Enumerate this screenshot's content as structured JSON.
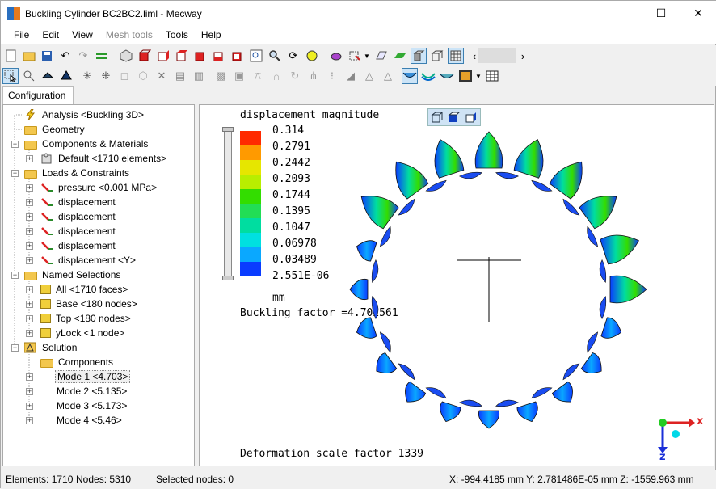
{
  "window": {
    "title": "Buckling Cylinder BC2BC2.liml - Mecway"
  },
  "menu": [
    {
      "label": "File",
      "disabled": false
    },
    {
      "label": "Edit",
      "disabled": false
    },
    {
      "label": "View",
      "disabled": false
    },
    {
      "label": "Mesh tools",
      "disabled": true
    },
    {
      "label": "Tools",
      "disabled": false
    },
    {
      "label": "Help",
      "disabled": false
    }
  ],
  "tabs": {
    "configuration": "Configuration"
  },
  "tree": {
    "analysis": "Analysis <Buckling 3D>",
    "geometry": "Geometry",
    "components_materials": "Components & Materials",
    "default": "Default <1710 elements>",
    "loads_constraints": "Loads & Constraints",
    "pressure": "pressure <0.001 MPa>",
    "displacement1": "displacement",
    "displacement2": "displacement",
    "displacement3": "displacement",
    "displacement4": "displacement",
    "displacement_y": "displacement <Y>",
    "named_selections": "Named Selections",
    "all": "All <1710 faces>",
    "base": "Base <180 nodes>",
    "top": "Top <180 nodes>",
    "ylock": "yLock <1 node>",
    "solution": "Solution",
    "components": "Components",
    "mode1": "Mode 1 <4.703>",
    "mode2": "Mode 2 <5.135>",
    "mode3": "Mode 3 <5.173>",
    "mode4": "Mode 4 <5.46>"
  },
  "viewport": {
    "title": "displacement magnitude",
    "legend_values": [
      "0.314",
      "0.2791",
      "0.2442",
      "0.2093",
      "0.1744",
      "0.1395",
      "0.1047",
      "0.06978",
      "0.03489",
      "2.551E-06"
    ],
    "legend_colors": [
      "#ff2a00",
      "#ff9a00",
      "#e6e600",
      "#b8ee00",
      "#33dd00",
      "#22dd55",
      "#00dda0",
      "#00e0e0",
      "#0aa8ff",
      "#0a3cff"
    ],
    "unit": "mm",
    "buckling": "Buckling factor =4.702561",
    "deformation": "Deformation scale factor 1339",
    "axes": {
      "x": "x",
      "z": "z"
    }
  },
  "status": {
    "elements": "Elements: 1710",
    "nodes": "Nodes: 5310",
    "selected": "Selected nodes: 0",
    "coords": "X: -994.4185 mm Y: 2.781486E-05 mm Z: -1559.963 mm"
  }
}
